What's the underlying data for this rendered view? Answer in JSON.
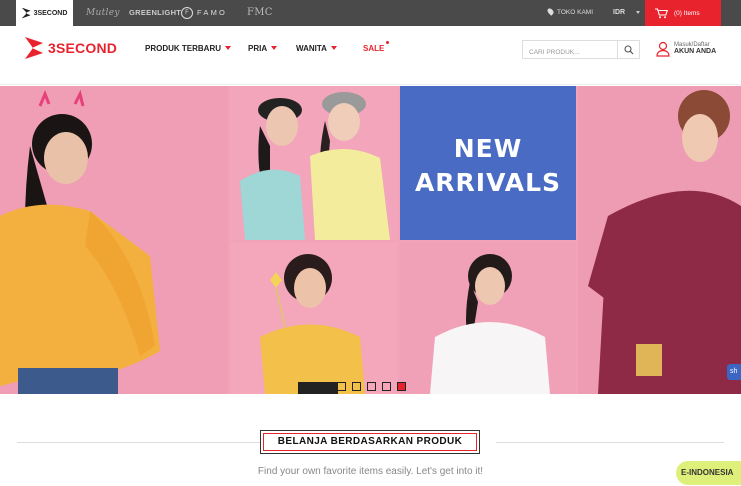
{
  "topbar": {
    "brands": [
      "3SECOND",
      "Mutley",
      "GREENLIGHT",
      "FAMO",
      "FMC"
    ],
    "store_label": "TOKO KAMI",
    "currency": "IDR",
    "cart_label": "(0) Items"
  },
  "nav": {
    "logo_text": "3SECOND",
    "items": [
      {
        "label": "PRODUK TERBARU"
      },
      {
        "label": "PRIA"
      },
      {
        "label": "WANITA"
      },
      {
        "label": "SALE"
      }
    ],
    "search_placeholder": "CARI PRODUK...",
    "account_sub": "Masuk/Daftar",
    "account_main": "AKUN ANDA"
  },
  "hero": {
    "banner_text_line1": "NEW",
    "banner_text_line2": "ARRIVALS",
    "slide_count": 5,
    "active_slide": 5,
    "side_tab": "sh"
  },
  "section": {
    "title": "BELANJA BERDASARKAN PRODUK",
    "subtitle": "Find your own favorite items easily. Let's get into it!"
  },
  "language_badge": "E-INDONESIA",
  "colors": {
    "brand_red": "#e8232e",
    "topbar_bg": "#4a4a4a",
    "hero_pink": "#f2a2b9",
    "hero_blue": "#4a6bc4",
    "lang_badge": "#dff07a"
  },
  "icons": [
    "pin-icon",
    "cart-icon",
    "search-icon",
    "user-icon",
    "chevron-down-icon"
  ]
}
